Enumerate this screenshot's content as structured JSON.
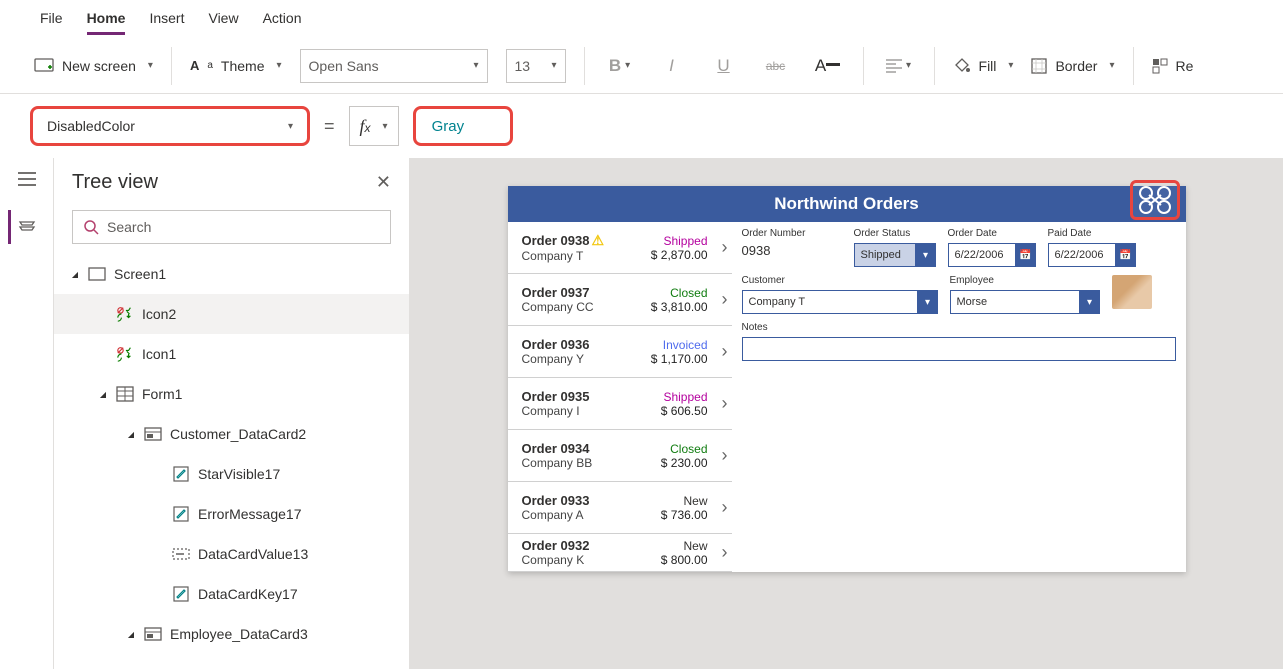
{
  "menubar": [
    "File",
    "Home",
    "Insert",
    "View",
    "Action"
  ],
  "menubar_active": 1,
  "toolbar": {
    "new_screen": "New screen",
    "theme": "Theme",
    "font": "Open Sans",
    "font_size": "13",
    "fill": "Fill",
    "border": "Border",
    "re": "Re"
  },
  "formula": {
    "property": "DisabledColor",
    "value": "Gray"
  },
  "tree": {
    "title": "Tree view",
    "search_placeholder": "Search",
    "items": [
      {
        "indent": 0,
        "caret": true,
        "icon": "screen",
        "label": "Screen1"
      },
      {
        "indent": 1,
        "caret": false,
        "icon": "iconctrl",
        "label": "Icon2",
        "selected": true
      },
      {
        "indent": 1,
        "caret": false,
        "icon": "iconctrl",
        "label": "Icon1"
      },
      {
        "indent": 1,
        "caret": true,
        "icon": "form",
        "label": "Form1"
      },
      {
        "indent": 2,
        "caret": true,
        "icon": "card",
        "label": "Customer_DataCard2"
      },
      {
        "indent": 3,
        "caret": false,
        "icon": "edit",
        "label": "StarVisible17"
      },
      {
        "indent": 3,
        "caret": false,
        "icon": "edit",
        "label": "ErrorMessage17"
      },
      {
        "indent": 3,
        "caret": false,
        "icon": "textbox",
        "label": "DataCardValue13"
      },
      {
        "indent": 3,
        "caret": false,
        "icon": "edit",
        "label": "DataCardKey17"
      },
      {
        "indent": 2,
        "caret": true,
        "icon": "card",
        "label": "Employee_DataCard3"
      }
    ]
  },
  "phone": {
    "title": "Northwind Orders",
    "orders": [
      {
        "num": "Order 0938",
        "company": "Company T",
        "status": "Shipped",
        "amt": "$ 2,870.00",
        "color": "#b4009e",
        "warn": true
      },
      {
        "num": "Order 0937",
        "company": "Company CC",
        "status": "Closed",
        "amt": "$ 3,810.00",
        "color": "#107c10"
      },
      {
        "num": "Order 0936",
        "company": "Company Y",
        "status": "Invoiced",
        "amt": "$ 1,170.00",
        "color": "#4f6bed"
      },
      {
        "num": "Order 0935",
        "company": "Company I",
        "status": "Shipped",
        "amt": "$ 606.50",
        "color": "#b4009e"
      },
      {
        "num": "Order 0934",
        "company": "Company BB",
        "status": "Closed",
        "amt": "$ 230.00",
        "color": "#107c10"
      },
      {
        "num": "Order 0933",
        "company": "Company A",
        "status": "New",
        "amt": "$ 736.00",
        "color": "#323130"
      },
      {
        "num": "Order 0932",
        "company": "Company K",
        "status": "New",
        "amt": "$ 800.00",
        "color": "#323130"
      }
    ],
    "detail": {
      "order_number_label": "Order Number",
      "order_number": "0938",
      "order_status_label": "Order Status",
      "order_status": "Shipped",
      "order_date_label": "Order Date",
      "order_date": "6/22/2006",
      "paid_date_label": "Paid Date",
      "paid_date": "6/22/2006",
      "customer_label": "Customer",
      "customer": "Company T",
      "employee_label": "Employee",
      "employee": "Morse",
      "notes_label": "Notes"
    }
  }
}
